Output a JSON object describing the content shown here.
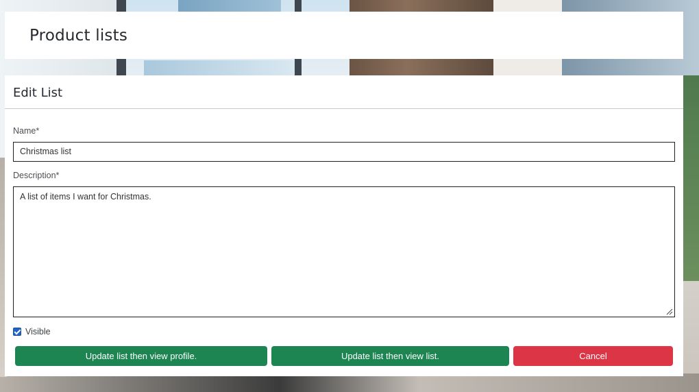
{
  "header": {
    "title": "Product lists"
  },
  "form": {
    "heading": "Edit List",
    "name": {
      "label": "Name*",
      "value": "Christmas list"
    },
    "description": {
      "label": "Description*",
      "value": "A list of items I want for Christmas."
    },
    "visible": {
      "label": "Visible",
      "checked": true
    },
    "buttons": {
      "update_profile": "Update list then view profile.",
      "update_list": "Update list then view list.",
      "cancel": "Cancel"
    }
  },
  "colors": {
    "primary_button": "#1d8552",
    "cancel_button": "#dc3545",
    "checkbox": "#1f63c6"
  }
}
